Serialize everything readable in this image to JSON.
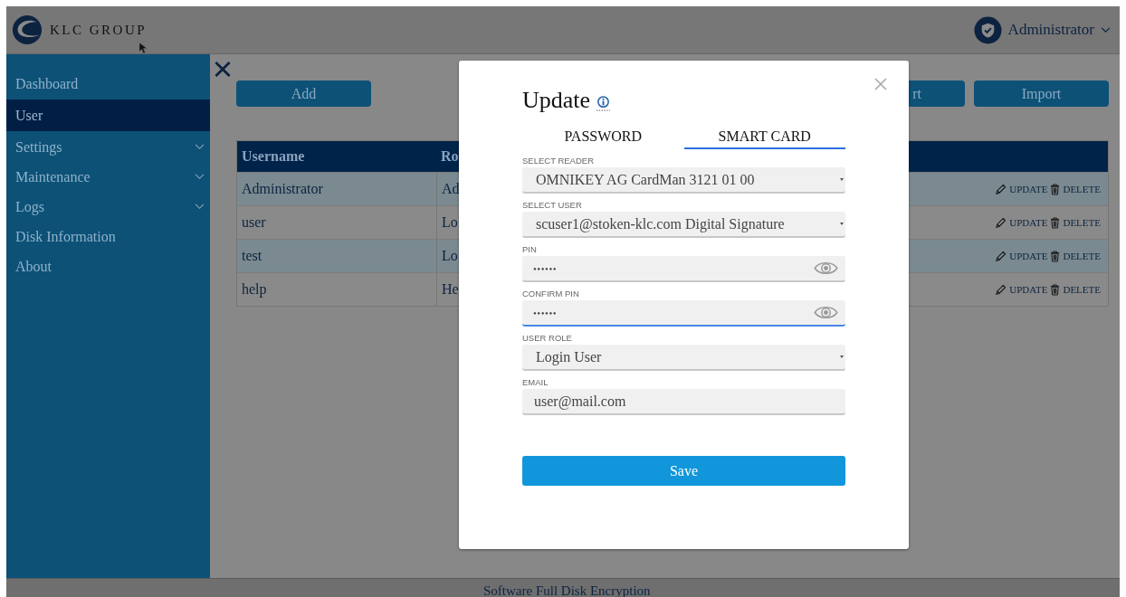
{
  "header": {
    "brand": "KLC GROUP",
    "user": "Administrator"
  },
  "sidebar": {
    "items": [
      {
        "label": "Dashboard",
        "selected": false,
        "expandable": false
      },
      {
        "label": "User",
        "selected": true,
        "expandable": false
      },
      {
        "label": "Settings",
        "selected": false,
        "expandable": true
      },
      {
        "label": "Maintenance",
        "selected": false,
        "expandable": true
      },
      {
        "label": "Logs",
        "selected": false,
        "expandable": true
      },
      {
        "label": "Disk Information",
        "selected": false,
        "expandable": false
      },
      {
        "label": "About",
        "selected": false,
        "expandable": false
      }
    ]
  },
  "toolbar": {
    "buttons": [
      {
        "label": "Add"
      },
      {
        "label": "rt"
      },
      {
        "label": "Import"
      }
    ]
  },
  "table": {
    "columns": [
      "Username",
      "Ro"
    ],
    "rows": [
      {
        "cells": [
          "Administrator",
          "Ad"
        ],
        "actions": [
          "UPDATE",
          "DELETE"
        ]
      },
      {
        "cells": [
          "user",
          "Lo"
        ],
        "actions": [
          "UPDATE",
          "DELETE"
        ]
      },
      {
        "cells": [
          "test",
          "Lo"
        ],
        "actions": [
          "UPDATE",
          "DELETE"
        ]
      },
      {
        "cells": [
          "help",
          "He"
        ],
        "actions": [
          "UPDATE",
          "DELETE"
        ]
      }
    ]
  },
  "dialog": {
    "title": "Update",
    "tabs": [
      {
        "label": "PASSWORD",
        "selected": false
      },
      {
        "label": "SMART CARD",
        "selected": true
      }
    ],
    "fields": [
      {
        "kind": "select",
        "label": "SELECT READER",
        "value": "OMNIKEY AG CardMan 3121 01 00",
        "focused": false
      },
      {
        "kind": "select",
        "label": "SELECT USER",
        "value": "scuser1@stoken-klc.com Digital Signature",
        "focused": false
      },
      {
        "kind": "secret",
        "label": "PIN",
        "value": "••••••",
        "focused": false
      },
      {
        "kind": "secret",
        "label": "CONFIRM PIN",
        "value": "••••••",
        "focused": true
      },
      {
        "kind": "select",
        "label": "USER ROLE",
        "value": "Login User",
        "focused": false
      },
      {
        "kind": "text",
        "label": "EMAIL",
        "value": "user@mail.com",
        "focused": false
      }
    ],
    "save": "Save"
  },
  "footer": "Software Full Disk Encryption"
}
